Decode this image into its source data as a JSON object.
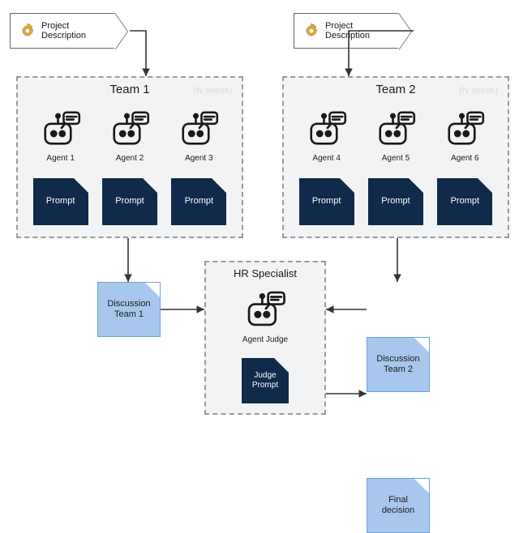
{
  "projectBox": {
    "label": "Project Description"
  },
  "team1": {
    "title": "Team 1",
    "watermark": "(N seeds)",
    "agents": [
      {
        "label": "Agent 1"
      },
      {
        "label": "Agent 2"
      },
      {
        "label": "Agent 3"
      }
    ],
    "promptLabel": "Prompt",
    "discussion": "Discussion\nTeam 1"
  },
  "team2": {
    "title": "Team 2",
    "watermark": "(N seeds)",
    "agents": [
      {
        "label": "Agent 4"
      },
      {
        "label": "Agent 5"
      },
      {
        "label": "Agent 6"
      }
    ],
    "promptLabel": "Prompt",
    "discussion": "Discussion\nTeam 2"
  },
  "hr": {
    "title": "HR Specialist",
    "agentLabel": "Agent Judge",
    "promptLabel": "Judge\nPrompt"
  },
  "finalDecision": "Final\ndecision",
  "diagram": {
    "type": "flowchart",
    "nodes": [
      {
        "id": "proj1",
        "type": "input",
        "label": "Project Description"
      },
      {
        "id": "proj2",
        "type": "input",
        "label": "Project Description"
      },
      {
        "id": "team1",
        "type": "group",
        "label": "Team 1",
        "children": [
          "a1",
          "a2",
          "a3",
          "p1",
          "p2",
          "p3"
        ]
      },
      {
        "id": "team2",
        "type": "group",
        "label": "Team 2",
        "children": [
          "a4",
          "a5",
          "a6",
          "p4",
          "p5",
          "p6"
        ]
      },
      {
        "id": "a1",
        "type": "agent",
        "label": "Agent 1"
      },
      {
        "id": "a2",
        "type": "agent",
        "label": "Agent 2"
      },
      {
        "id": "a3",
        "type": "agent",
        "label": "Agent 3"
      },
      {
        "id": "a4",
        "type": "agent",
        "label": "Agent 4"
      },
      {
        "id": "a5",
        "type": "agent",
        "label": "Agent 5"
      },
      {
        "id": "a6",
        "type": "agent",
        "label": "Agent 6"
      },
      {
        "id": "p1",
        "type": "prompt",
        "label": "Prompt"
      },
      {
        "id": "p2",
        "type": "prompt",
        "label": "Prompt"
      },
      {
        "id": "p3",
        "type": "prompt",
        "label": "Prompt"
      },
      {
        "id": "p4",
        "type": "prompt",
        "label": "Prompt"
      },
      {
        "id": "p5",
        "type": "prompt",
        "label": "Prompt"
      },
      {
        "id": "p6",
        "type": "prompt",
        "label": "Prompt"
      },
      {
        "id": "disc1",
        "type": "document",
        "label": "Discussion Team 1"
      },
      {
        "id": "disc2",
        "type": "document",
        "label": "Discussion Team 2"
      },
      {
        "id": "hr",
        "type": "group",
        "label": "HR Specialist",
        "children": [
          "judge",
          "jp"
        ]
      },
      {
        "id": "judge",
        "type": "agent",
        "label": "Agent Judge"
      },
      {
        "id": "jp",
        "type": "prompt",
        "label": "Judge Prompt"
      },
      {
        "id": "final",
        "type": "document",
        "label": "Final decision"
      }
    ],
    "edges": [
      {
        "from": "proj1",
        "to": "team1"
      },
      {
        "from": "proj2",
        "to": "team2"
      },
      {
        "from": "team1",
        "to": "disc1"
      },
      {
        "from": "team2",
        "to": "disc2"
      },
      {
        "from": "disc1",
        "to": "hr"
      },
      {
        "from": "disc2",
        "to": "hr"
      },
      {
        "from": "hr",
        "to": "final"
      }
    ]
  }
}
